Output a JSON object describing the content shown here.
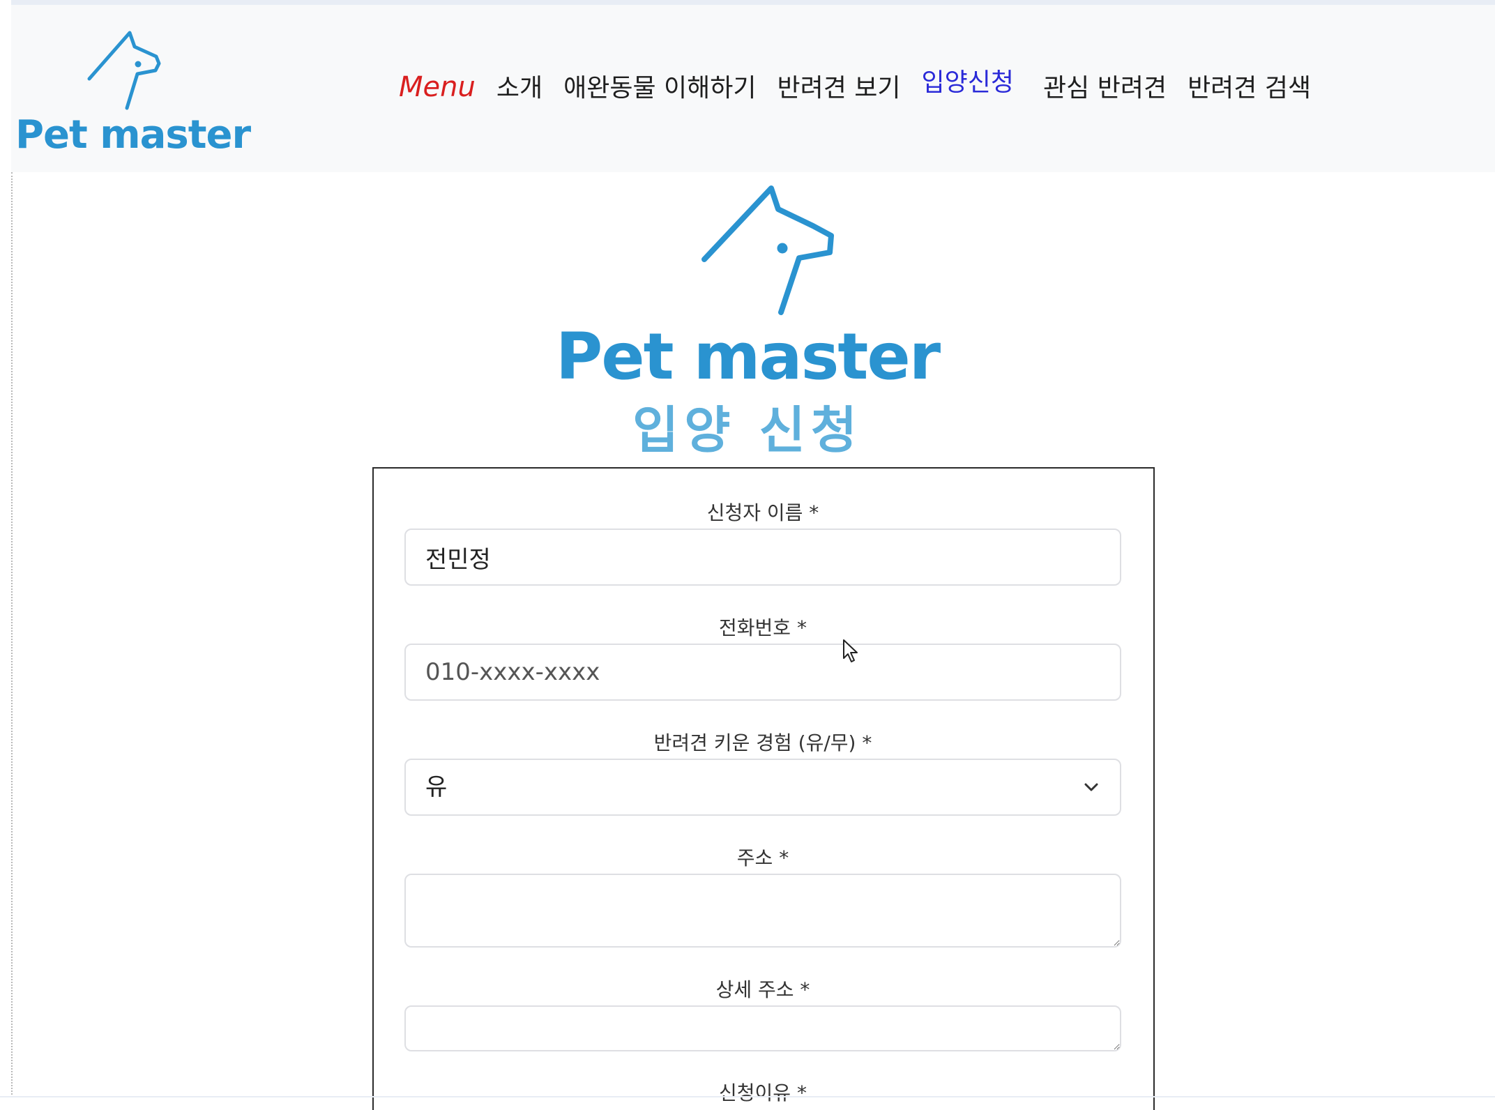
{
  "navbar": {
    "logo_text": "Pet master",
    "menu_label": "Menu",
    "links": [
      {
        "label": "소개",
        "active": false
      },
      {
        "label": "애완동물 이해하기",
        "active": false
      },
      {
        "label": "반려견 보기",
        "active": false
      },
      {
        "label": "입양신청",
        "active": true
      },
      {
        "label": "관심 반려견",
        "active": false
      },
      {
        "label": "반려견 검색",
        "active": false
      }
    ]
  },
  "hero": {
    "title": "Pet master",
    "subtitle": "입양 신청"
  },
  "form": {
    "name": {
      "label": "신청자 이름 *",
      "value": "전민정"
    },
    "phone": {
      "label": "전화번호 *",
      "value": "",
      "placeholder": "010-xxxx-xxxx"
    },
    "experience": {
      "label": "반려견 키운 경험 (유/무) *",
      "selected": "유"
    },
    "address": {
      "label": "주소 *",
      "value": ""
    },
    "address_detail": {
      "label": "상세 주소 *",
      "value": ""
    },
    "reason": {
      "label": "신청이유 *"
    }
  },
  "colors": {
    "brand": "#2a93d0",
    "brand_light": "#5fb0dc",
    "menu_label": "#d91f1f",
    "active_link": "#2a2ad8",
    "navbar_bg": "#f8f9fa"
  },
  "icons": {
    "logo": "dog-head-icon",
    "select": "chevron-down-icon",
    "pointer": "mouse-cursor-icon"
  }
}
